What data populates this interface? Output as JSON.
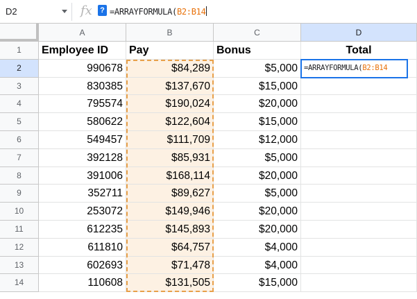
{
  "formula_bar": {
    "name_box": "D2",
    "fx_label": "fx",
    "help_badge": "?",
    "formula_prefix": "=ARRAYFORMULA(",
    "formula_range": "B2:B14"
  },
  "columns": [
    "A",
    "B",
    "C",
    "D"
  ],
  "headers": {
    "employee_id": "Employee ID",
    "pay": "Pay",
    "bonus": "Bonus",
    "total": "Total"
  },
  "rows": [
    {
      "num": "1"
    },
    {
      "num": "2",
      "id": "990678",
      "pay": "$84,289",
      "bonus": "$5,000"
    },
    {
      "num": "3",
      "id": "830385",
      "pay": "$137,670",
      "bonus": "$15,000"
    },
    {
      "num": "4",
      "id": "795574",
      "pay": "$190,024",
      "bonus": "$20,000"
    },
    {
      "num": "5",
      "id": "580622",
      "pay": "$122,604",
      "bonus": "$15,000"
    },
    {
      "num": "6",
      "id": "549457",
      "pay": "$111,709",
      "bonus": "$12,000"
    },
    {
      "num": "7",
      "id": "392128",
      "pay": "$85,931",
      "bonus": "$5,000"
    },
    {
      "num": "8",
      "id": "391006",
      "pay": "$168,114",
      "bonus": "$20,000"
    },
    {
      "num": "9",
      "id": "352711",
      "pay": "$89,627",
      "bonus": "$5,000"
    },
    {
      "num": "10",
      "id": "253072",
      "pay": "$149,946",
      "bonus": "$20,000"
    },
    {
      "num": "11",
      "id": "612235",
      "pay": "$145,893",
      "bonus": "$20,000"
    },
    {
      "num": "12",
      "id": "611810",
      "pay": "$64,757",
      "bonus": "$4,000"
    },
    {
      "num": "13",
      "id": "602693",
      "pay": "$71,478",
      "bonus": "$4,000"
    },
    {
      "num": "14",
      "id": "110608",
      "pay": "$131,505",
      "bonus": "$15,000"
    }
  ],
  "active_cell_editor": {
    "prefix": "=ARRAYFORMULA(",
    "range": "B2:B14"
  },
  "colors": {
    "range_highlight": "#e8a04a",
    "active_border": "#1a73e8"
  }
}
